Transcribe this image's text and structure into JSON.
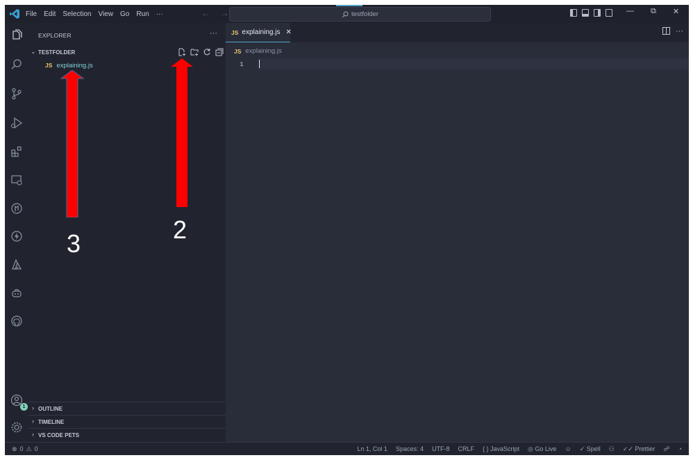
{
  "titlebar": {
    "menu": [
      "File",
      "Edit",
      "Selection",
      "View",
      "Go",
      "Run",
      "···"
    ],
    "nav_arrows": "← →",
    "search_text": "testfolder",
    "window_controls": [
      "—",
      "⧉",
      "✕"
    ]
  },
  "activity_bar": {
    "icons": [
      "files-icon",
      "search-icon",
      "source-control-icon",
      "run-debug-icon",
      "extensions-icon",
      "remote-explorer-icon",
      "gitlens-icon",
      "thunder-client-icon",
      "azure-icon",
      "copilot-icon",
      "github-icon",
      "account-icon",
      "settings-gear-icon"
    ],
    "account_badge": "1"
  },
  "sidebar": {
    "title": "EXPLORER",
    "more": "···",
    "folder": "TESTFOLDER",
    "files": [
      {
        "badge": "JS",
        "name": "explaining.js"
      }
    ],
    "panels": [
      "OUTLINE",
      "TIMELINE",
      "VS CODE PETS"
    ]
  },
  "editor": {
    "tab": {
      "badge": "JS",
      "label": "explaining.js",
      "close": "✕"
    },
    "actions": [
      "split-editor-icon",
      "···"
    ],
    "breadcrumb": {
      "badge": "JS",
      "file": "explaining.js"
    },
    "line_number": "1"
  },
  "statusbar": {
    "errors": "0",
    "warnings": "0",
    "position": "Ln 1, Col 1",
    "spaces": "Spaces: 4",
    "encoding": "UTF-8",
    "eol": "CRLF",
    "language": "JavaScript",
    "go_live": "Go Live",
    "spell": "Spell",
    "prettier": "Prettier"
  },
  "annotations": {
    "arrow_left_label": "3",
    "arrow_right_label": "2",
    "arrow_color": "#ff0000"
  },
  "colors": {
    "background": "#262a37",
    "sidebar": "#21242f",
    "accent": "#56a5c8",
    "js_yellow": "#e9c46a",
    "file_teal": "#7fd1d6"
  }
}
